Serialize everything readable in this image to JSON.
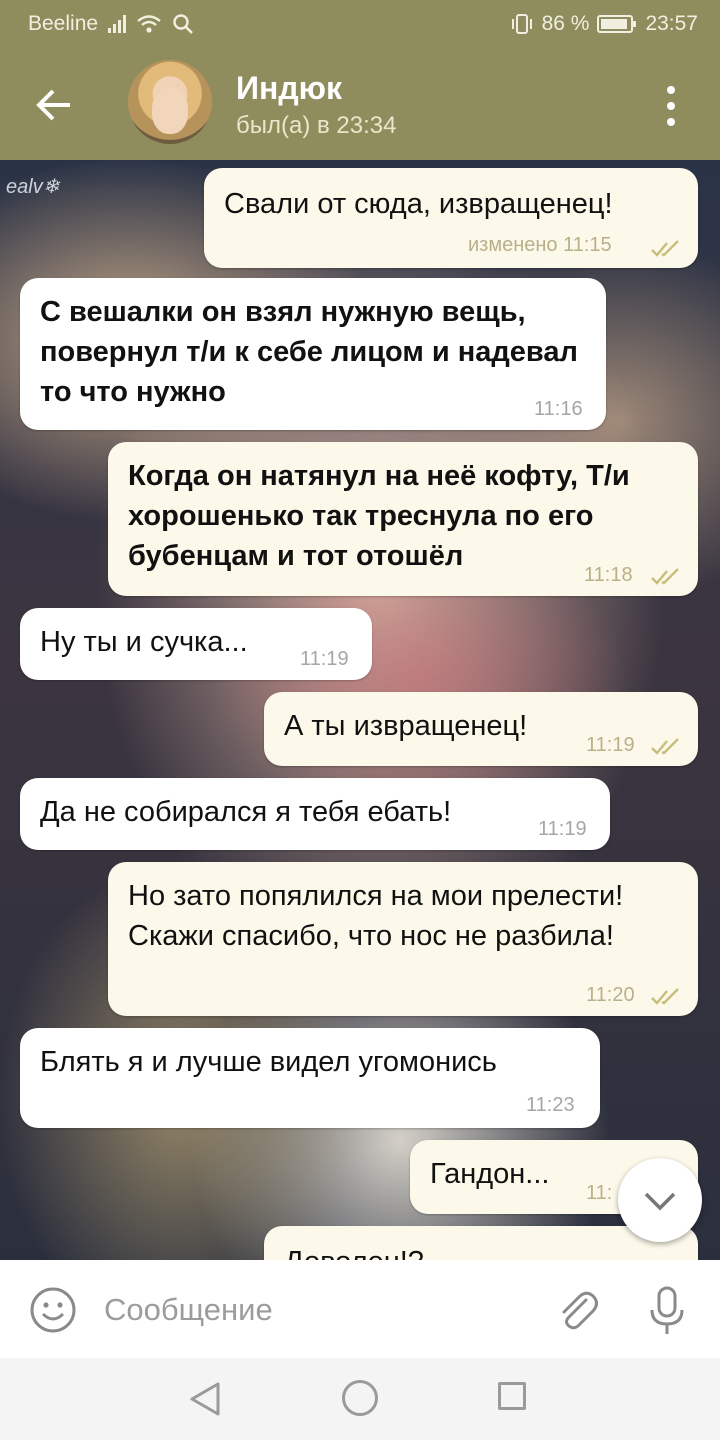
{
  "status_bar": {
    "carrier": "Beeline",
    "battery": "86 %",
    "time": "23:57"
  },
  "header": {
    "title": "Индюк",
    "status": "был(а) в 23:34"
  },
  "background": {
    "watermark": "ealv❄"
  },
  "messages": [
    {
      "dir": "out",
      "bold": false,
      "text": "Свали от сюда, извращенец!",
      "time": "изменено 11:15",
      "read": true
    },
    {
      "dir": "in",
      "bold": true,
      "text": "С вешалки он взял нужную вещь, повернул т/и к себе лицом и надевал то что нужно",
      "time": "11:16"
    },
    {
      "dir": "out",
      "bold": true,
      "text": "Когда он натянул на неё кофту, Т/и хорошенько так треснула по его бубенцам и тот отошёл",
      "time": "11:18",
      "read": true
    },
    {
      "dir": "in",
      "bold": false,
      "text": "Ну ты и сучка...",
      "time": "11:19"
    },
    {
      "dir": "out",
      "bold": false,
      "text": "А ты извращенец!",
      "time": "11:19",
      "read": true
    },
    {
      "dir": "in",
      "bold": false,
      "text": "Да не собирался я тебя ебать!",
      "time": "11:19"
    },
    {
      "dir": "out",
      "bold": false,
      "text": "Но зато попялился на мои прелести! Скажи спасибо, что нос не разбила!",
      "time": "11:20",
      "read": true
    },
    {
      "dir": "in",
      "bold": false,
      "text": "Блять я и лучше видел угомонись",
      "time": "11:23"
    },
    {
      "dir": "out",
      "bold": false,
      "text": "Гандон...",
      "time": "11:"
    },
    {
      "dir": "out",
      "bold": false,
      "text": "Доволен!?",
      "time": ""
    }
  ],
  "composer": {
    "placeholder": "Сообщение"
  },
  "colors": {
    "header": "#8f8c5e",
    "bubble_out": "#fcf9ea",
    "bubble_in": "#ffffff",
    "check": "#c9bd7d"
  },
  "icons": {
    "back": "arrow-left-icon",
    "menu": "more-vert-icon",
    "emoji": "smiley-icon",
    "attach": "paperclip-icon",
    "mic": "microphone-icon",
    "scroll": "chevron-down-icon"
  }
}
